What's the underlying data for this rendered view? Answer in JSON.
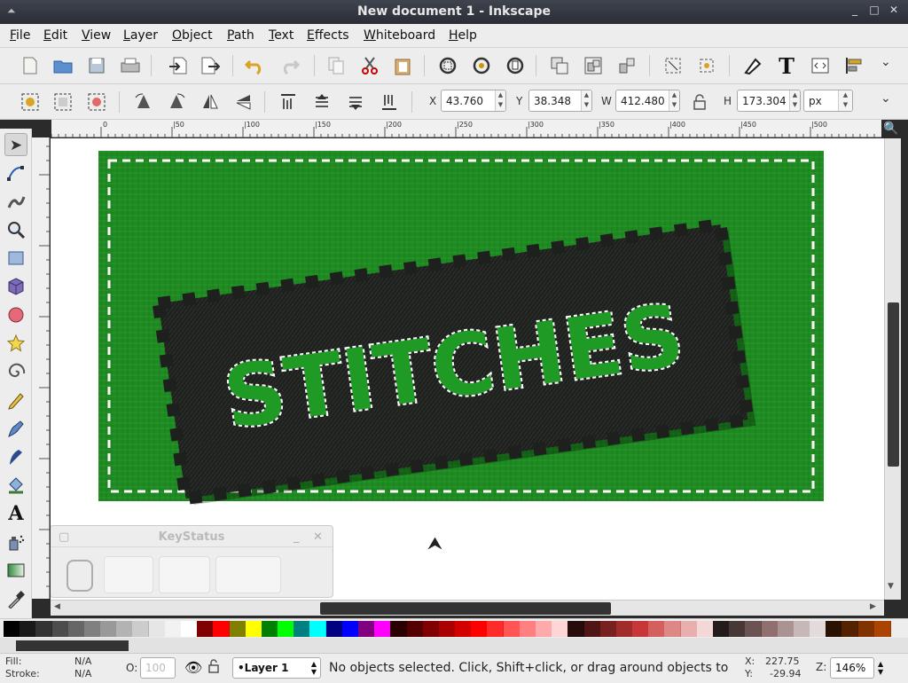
{
  "window": {
    "title": "New document 1 - Inkscape",
    "controls": [
      "_",
      "□",
      "✕"
    ]
  },
  "menu": [
    "File",
    "Edit",
    "View",
    "Layer",
    "Object",
    "Path",
    "Text",
    "Effects",
    "Whiteboard",
    "Help"
  ],
  "command_bar_icons": [
    "new-document-icon",
    "open-icon",
    "save-icon",
    "print-icon",
    "import-icon",
    "export-icon",
    "undo-icon",
    "redo-icon",
    "copy-icon",
    "cut-icon",
    "paste-icon",
    "zoom-selection-icon",
    "zoom-drawing-icon",
    "zoom-page-icon",
    "duplicate-icon",
    "group-icon",
    "ungroup-icon",
    "fill-stroke-icon",
    "text-font-icon",
    "xml-editor-icon",
    "align-distribute-icon"
  ],
  "selector": {
    "x_label": "X",
    "x": "43.760",
    "y_label": "Y",
    "y": "38.348",
    "w_label": "W",
    "w": "412.480",
    "h_label": "H",
    "h": "173.304",
    "unit": "px"
  },
  "ruler_ticks": [
    "0",
    "|50",
    "|100",
    "|150",
    "|200",
    "|250",
    "|300",
    "|350",
    "|400",
    "|450",
    "|500"
  ],
  "tools": [
    "selector-tool",
    "node-tool",
    "tweak-tool",
    "zoom-tool",
    "rectangle-tool",
    "3d-box-tool",
    "ellipse-tool",
    "star-tool",
    "spiral-tool",
    "pencil-tool",
    "pen-tool",
    "calligraphy-tool",
    "paint-bucket-tool",
    "text-tool",
    "spray-tool",
    "gradient-tool",
    "dropper-tool"
  ],
  "artwork": {
    "text": "STITCHES",
    "background_color": "#1f8a22",
    "patch_color": "#1e201e",
    "letter_color": "#1e9a25",
    "stitch_color": "#ffffff"
  },
  "keystatus": {
    "title": "KeyStatus",
    "minimize": "_",
    "close": "✕"
  },
  "palette": [
    "#000000",
    "#1a1a1a",
    "#333333",
    "#4d4d4d",
    "#666666",
    "#808080",
    "#999999",
    "#b3b3b3",
    "#cccccc",
    "#e6e6e6",
    "#f2f2f2",
    "#ffffff",
    "#800000",
    "#ff0000",
    "#808000",
    "#ffff00",
    "#008000",
    "#00ff00",
    "#008080",
    "#00ffff",
    "#000080",
    "#0000ff",
    "#800080",
    "#ff00ff",
    "#2b0000",
    "#550000",
    "#800000",
    "#aa0000",
    "#d40000",
    "#ff0000",
    "#ff2a2a",
    "#ff5555",
    "#ff8080",
    "#ffaaaa",
    "#ffd5d5",
    "#280b0b",
    "#501616",
    "#782121",
    "#a02c2c",
    "#c83737",
    "#d35f5f",
    "#de8787",
    "#e9afaf",
    "#f4d7d7",
    "#241c1c",
    "#483737",
    "#6c5353",
    "#916f6f",
    "#ac9393",
    "#c8b7b7",
    "#e3dbdb",
    "#2b1100",
    "#552200",
    "#803300",
    "#aa4400"
  ],
  "status": {
    "fill_label": "Fill:",
    "fill": "N/A",
    "stroke_label": "Stroke:",
    "stroke": "N/A",
    "opacity_label": "O:",
    "opacity": "100",
    "layer": "•Layer 1",
    "message": "No objects selected. Click, Shift+click, or drag around objects to",
    "x_label": "X:",
    "x": "227.75",
    "y_label": "Y:",
    "y": "-29.94",
    "zoom_label": "Z:",
    "zoom": "146%"
  }
}
